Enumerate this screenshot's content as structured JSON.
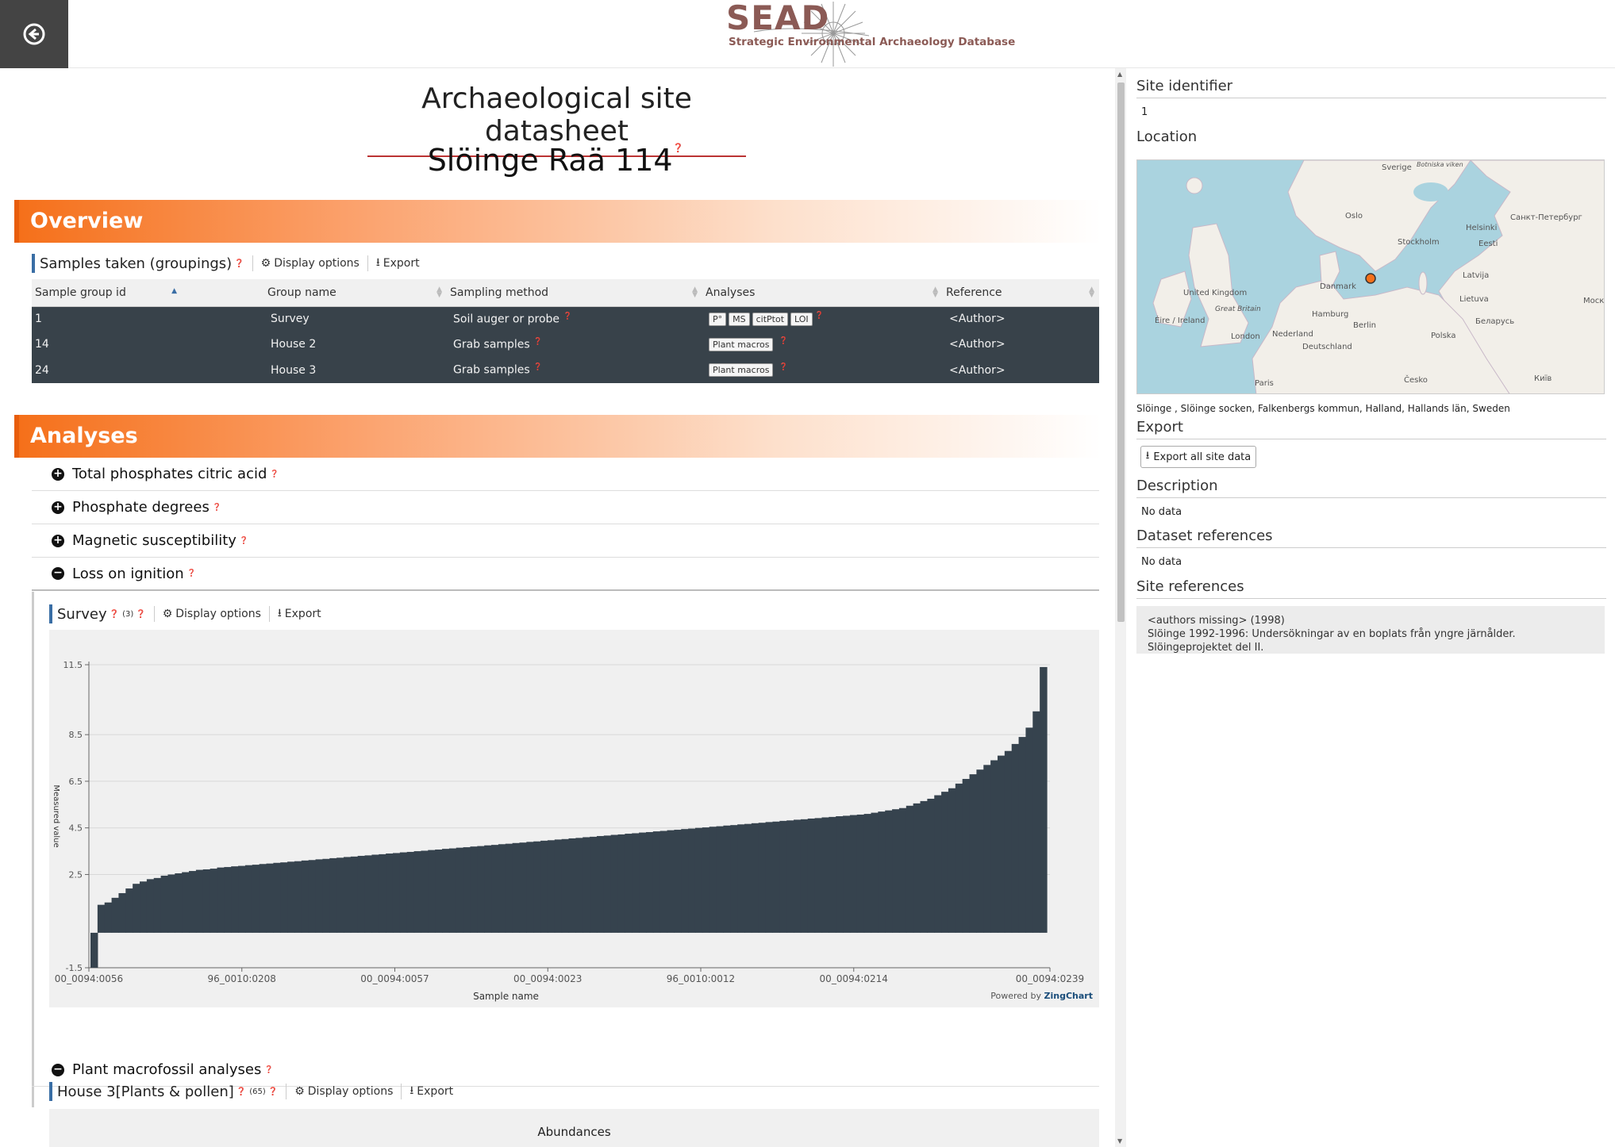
{
  "header": {
    "logo_title": "SEAD",
    "logo_subtitle": "Strategic Environmental Archaeology Database"
  },
  "page": {
    "title": "Archaeological site datasheet",
    "site_name": "Slöinge  Raä 114"
  },
  "overview": {
    "banner": "Overview",
    "samples_title": "Samples taken (groupings)",
    "display_options": "Display options",
    "export": "Export",
    "columns": [
      "Sample group id",
      "Group name",
      "Sampling method",
      "Analyses",
      "Reference"
    ],
    "rows": [
      {
        "id": "1",
        "name": "Survey",
        "method": "Soil auger or probe",
        "analyses": [
          "P°",
          "MS",
          "citPtot",
          "LOI"
        ],
        "reference": "<Author>"
      },
      {
        "id": "14",
        "name": "House 2",
        "method": "Grab samples",
        "analyses": [
          "Plant macros"
        ],
        "reference": "<Author>"
      },
      {
        "id": "24",
        "name": "House 3",
        "method": "Grab samples",
        "analyses": [
          "Plant macros"
        ],
        "reference": "<Author>"
      }
    ]
  },
  "analyses": {
    "banner": "Analyses",
    "items": [
      {
        "label": "Total phosphates citric acid",
        "state": "+"
      },
      {
        "label": "Phosphate degrees",
        "state": "+"
      },
      {
        "label": "Magnetic susceptibility",
        "state": "+"
      },
      {
        "label": "Loss on ignition",
        "state": "−"
      }
    ],
    "survey_title": "Survey",
    "survey_count": "(3)",
    "plant_macro_label": "Plant macrofossil analyses",
    "house3_title": "House 3[Plants & pollen]",
    "house3_count": "(65)",
    "abundances": "Abundances",
    "powered_by": "Powered by",
    "zingchart": "ZingChart"
  },
  "chart_data": {
    "type": "bar",
    "title": "",
    "xlabel": "Sample name",
    "ylabel": "Measured value",
    "ylim": [
      -1.5,
      11.5
    ],
    "yticks": [
      -1.5,
      2.5,
      4.5,
      6.5,
      8.5,
      11.5
    ],
    "xtick_labels": [
      "00_0094:0056",
      "96_0010:0208",
      "00_0094:0057",
      "00_0094:0023",
      "96_0010:0012",
      "00_0094:0214",
      "00_0094:0239"
    ],
    "series": [
      {
        "values": [
          -1.5,
          1.2,
          1.3,
          1.5,
          1.7,
          1.9,
          2.1,
          2.2,
          2.3,
          2.35,
          2.45,
          2.5,
          2.55,
          2.6,
          2.65,
          2.7,
          2.72,
          2.75,
          2.8,
          2.82,
          2.85,
          2.87,
          2.9,
          2.92,
          2.95,
          2.97,
          3.0,
          3.02,
          3.05,
          3.07,
          3.1,
          3.12,
          3.15,
          3.17,
          3.2,
          3.22,
          3.25,
          3.27,
          3.3,
          3.32,
          3.35,
          3.37,
          3.4,
          3.42,
          3.45,
          3.47,
          3.5,
          3.52,
          3.55,
          3.57,
          3.6,
          3.62,
          3.65,
          3.67,
          3.7,
          3.72,
          3.75,
          3.77,
          3.8,
          3.82,
          3.85,
          3.87,
          3.9,
          3.92,
          3.95,
          3.97,
          4.0,
          4.02,
          4.05,
          4.07,
          4.1,
          4.12,
          4.15,
          4.17,
          4.2,
          4.22,
          4.25,
          4.27,
          4.3,
          4.32,
          4.35,
          4.37,
          4.4,
          4.42,
          4.45,
          4.47,
          4.5,
          4.52,
          4.55,
          4.57,
          4.6,
          4.62,
          4.65,
          4.67,
          4.7,
          4.72,
          4.75,
          4.77,
          4.8,
          4.82,
          4.85,
          4.87,
          4.9,
          4.92,
          4.95,
          4.97,
          5.0,
          5.02,
          5.05,
          5.07,
          5.1,
          5.15,
          5.2,
          5.25,
          5.3,
          5.35,
          5.45,
          5.55,
          5.65,
          5.75,
          5.9,
          6.05,
          6.2,
          6.4,
          6.6,
          6.8,
          7.0,
          7.2,
          7.4,
          7.6,
          7.8,
          8.1,
          8.4,
          8.8,
          9.5,
          11.4
        ]
      }
    ],
    "color": "#36434e"
  },
  "sidebar": {
    "site_identifier_label": "Site identifier",
    "site_identifier": "1",
    "location_label": "Location",
    "location_text": "Slöinge , Slöinge socken,  Falkenbergs kommun,  Halland,  Hallands län, Sweden",
    "export_label": "Export",
    "export_button": "Export all site data",
    "description_label": "Description",
    "description": "No data",
    "dataset_refs_label": "Dataset references",
    "dataset_refs": "No data",
    "site_refs_label": "Site references",
    "site_ref_line1": "<authors missing> (1998)",
    "site_ref_line2": "Slöinge 1992-1996: Undersökningar av en boplats från yngre järnålder. Slöingeprojektet del  II.",
    "map_labels": [
      "Sverige",
      "Oslo",
      "Stockholm",
      "Helsinki",
      "Санкт-Петербург",
      "Eesti",
      "Latvija",
      "Lietuva",
      "Беларусь",
      "Danmark",
      "United Kingdom",
      "Great Britain",
      "Éire / Ireland",
      "Hamburg",
      "Berlin",
      "London",
      "Nederland",
      "Deutschland",
      "Polska",
      "Paris",
      "Česko",
      "Київ",
      "Моск",
      "Botniska viken"
    ]
  }
}
